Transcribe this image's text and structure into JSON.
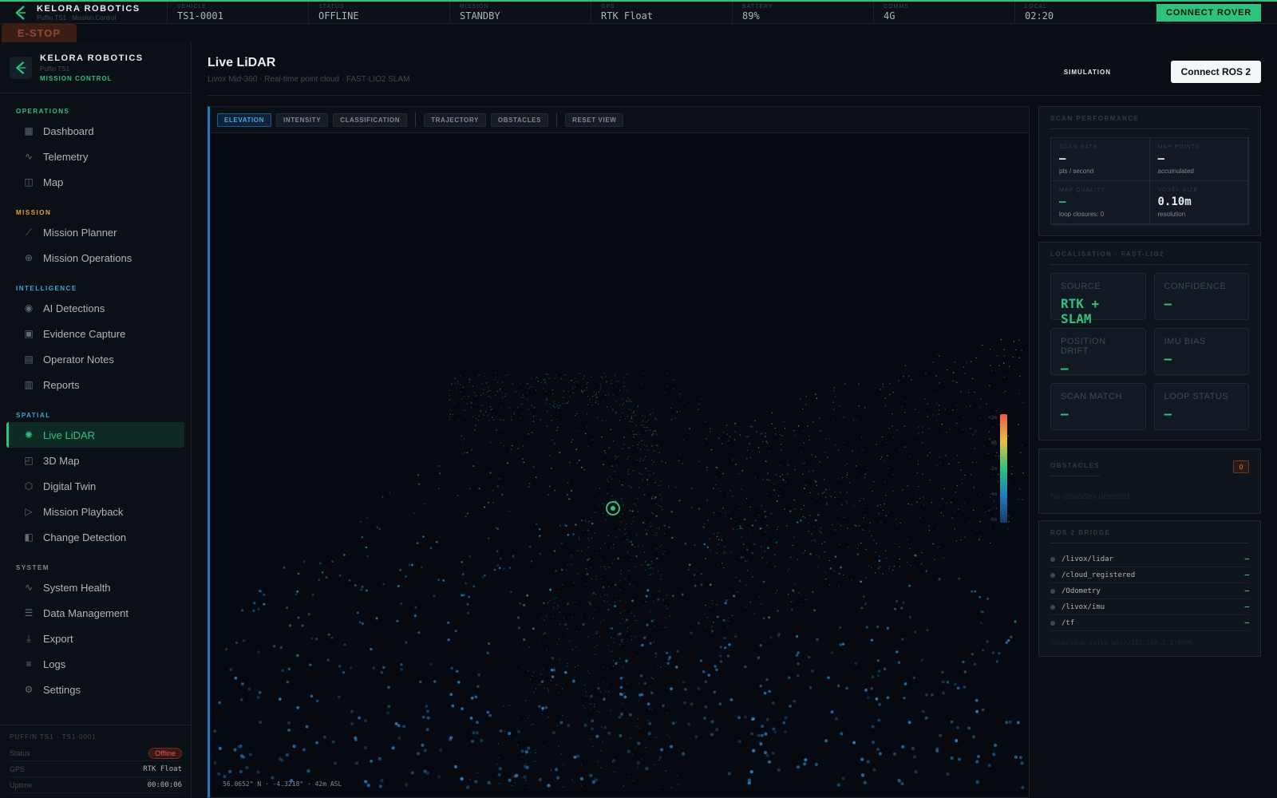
{
  "brand": {
    "name": "KELORA ROBOTICS",
    "subtitle": "Puffin TS1 · Mission Control",
    "product": "Puffin TS1",
    "console": "MISSION CONTROL"
  },
  "topbar": {
    "cells": [
      {
        "label": "VEHICLE",
        "value": "TS1-0001"
      },
      {
        "label": "STATUS",
        "value": "OFFLINE"
      },
      {
        "label": "MISSION",
        "value": "STANDBY"
      },
      {
        "label": "GPS",
        "value": "RTK Float"
      },
      {
        "label": "BATTERY",
        "value": "89%"
      },
      {
        "label": "COMMS",
        "value": "4G"
      },
      {
        "label": "LOCAL",
        "value": "02:20"
      }
    ],
    "connect_label": "CONNECT ROVER",
    "estop_label": "E-STOP"
  },
  "sidebar": {
    "sections": [
      {
        "title": "OPERATIONS",
        "color": "#2ec27e",
        "items": [
          {
            "label": "Dashboard",
            "icon": "grid-icon"
          },
          {
            "label": "Telemetry",
            "icon": "pulse-icon"
          },
          {
            "label": "Map",
            "icon": "map-icon"
          }
        ]
      },
      {
        "title": "MISSION",
        "color": "#e8a23a",
        "items": [
          {
            "label": "Mission Planner",
            "icon": "route-icon"
          },
          {
            "label": "Mission Operations",
            "icon": "crosshair-icon"
          }
        ]
      },
      {
        "title": "INTELLIGENCE",
        "color": "#3aa6d8",
        "items": [
          {
            "label": "AI Detections",
            "icon": "eye-icon"
          },
          {
            "label": "Evidence Capture",
            "icon": "camera-icon"
          },
          {
            "label": "Operator Notes",
            "icon": "note-icon"
          },
          {
            "label": "Reports",
            "icon": "report-icon"
          }
        ]
      },
      {
        "title": "SPATIAL",
        "color": "#3aa6d8",
        "items": [
          {
            "label": "Live LiDAR",
            "icon": "lidar-icon",
            "active": true
          },
          {
            "label": "3D Map",
            "icon": "cube-3d-icon"
          },
          {
            "label": "Digital Twin",
            "icon": "twin-icon"
          },
          {
            "label": "Mission Playback",
            "icon": "play-icon"
          },
          {
            "label": "Change Detection",
            "icon": "compare-icon"
          }
        ]
      },
      {
        "title": "SYSTEM",
        "color": "#7a8a96",
        "items": [
          {
            "label": "System Health",
            "icon": "pulse-icon"
          },
          {
            "label": "Data Management",
            "icon": "database-icon"
          },
          {
            "label": "Export",
            "icon": "download-icon"
          },
          {
            "label": "Logs",
            "icon": "logs-icon"
          },
          {
            "label": "Settings",
            "icon": "gear-icon"
          }
        ]
      }
    ],
    "footer": {
      "title": "PUFFIN TS1 · TS1-0001",
      "status_label": "Status",
      "status_value": "Offline",
      "gps_label": "GPS",
      "gps_value": "RTK Float",
      "uptime_label": "Uptime",
      "uptime_value": "00:00:06"
    }
  },
  "page": {
    "title": "Live LiDAR",
    "subtitle": "Livox Mid-360 · Real-time point cloud · FAST-LIO2 SLAM",
    "mode": "SIMULATION",
    "ros_button": "Connect ROS 2"
  },
  "viewport": {
    "toolbar": {
      "color_modes": [
        "ELEVATION",
        "INTENSITY",
        "CLASSIFICATION"
      ],
      "active_mode": "ELEVATION",
      "layers": [
        "TRAJECTORY",
        "OBSTACLES"
      ],
      "reset": "RESET VIEW"
    },
    "coords": "56.0652° N · -4.3218° · 42m ASL",
    "scale_labels": [
      "+2m",
      "0m",
      "-2m",
      "-4m",
      "-6m"
    ]
  },
  "scan_performance": {
    "title": "SCAN PERFORMANCE",
    "cells": [
      {
        "label": "SCAN RATE",
        "value": "—",
        "unit": "pts / second"
      },
      {
        "label": "MAP POINTS",
        "value": "—",
        "unit": "accumulated"
      },
      {
        "label": "MAP QUALITY",
        "value": "—",
        "unit": "loop closures: 0",
        "green": true
      },
      {
        "label": "VOXEL SIZE",
        "value": "0.10m",
        "unit": "resolution"
      }
    ]
  },
  "localisation": {
    "title": "LOCALISATION · FAST-LIO2",
    "cells": [
      {
        "label": "SOURCE",
        "value": "RTK + SLAM"
      },
      {
        "label": "CONFIDENCE",
        "value": "—"
      },
      {
        "label": "POSITION DRIFT",
        "value": "—"
      },
      {
        "label": "IMU BIAS",
        "value": "—"
      },
      {
        "label": "SCAN MATCH",
        "value": "—"
      },
      {
        "label": "LOOP STATUS",
        "value": "—"
      }
    ]
  },
  "obstacles": {
    "title": "OBSTACLES",
    "count": "0",
    "empty": "No obstacles detected"
  },
  "ros_bridge": {
    "title": "ROS 2 BRIDGE",
    "topics": [
      {
        "topic": "/livox/lidar",
        "status": "—"
      },
      {
        "topic": "/cloud_registered",
        "status": "—"
      },
      {
        "topic": "/Odometry",
        "status": "—"
      },
      {
        "topic": "/livox/imu",
        "status": "—"
      },
      {
        "topic": "/tf",
        "status": "—"
      }
    ],
    "url": "rosbridge_suite ws://192.168.1.1:9090"
  }
}
